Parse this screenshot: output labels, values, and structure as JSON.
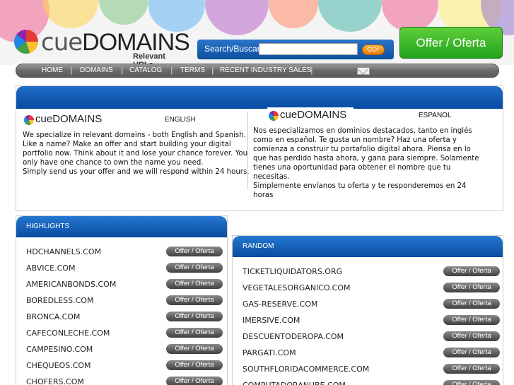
{
  "header": {
    "logo_text_cue": "cue",
    "logo_text_domains": "DOMAINS",
    "logo_subtitle": "Relevant URLs",
    "search_label": "Search/Buscar",
    "search_placeholder": "",
    "search_button": "GO!",
    "offer_button": "Offer / Oferta"
  },
  "nav": {
    "items": [
      "HOME",
      "DOMAINS",
      "CATALOG",
      "TERMS",
      "RECENT INDUSTRY SALES"
    ]
  },
  "intro": {
    "english_label": "ENGLISH",
    "spanish_label": "ESPANOL",
    "english_text": "We specialize in relevant domains - both English and Spanish. Like a name? Make an offer and start building your digital portfolio now. Think about it and lose your chance forever. You only have one chance to own the name you need.\nSimply send us your offer and we will respond within 24 hours.",
    "spanish_text": "Nos especializamos en dominios destacados, tanto en inglés como en español. Te gusta un nombre? Haz una oferta y comienza a construir tu portafolio digital ahora. Piensa en lo que has perdido hasta ahora, y gana para siempre. Solamente tienes una oportunidad para obtener el nombre que tu necesitas.\nSimplemente envíanos tu oferta y te responderemos en 24 horas"
  },
  "highlights": {
    "title": "HIGHLIGHTS",
    "button_label": "Offer / Oferta",
    "items": [
      "HDCHANNELS.COM",
      "ABVICE.COM",
      "AMERICANBONDS.COM",
      "BOREDLESS.COM",
      "BRONCA.COM",
      "CAFECONLECHE.COM",
      "CAMPESINO.COM",
      "CHEQUEOS.COM",
      "CHOFERS.COM"
    ]
  },
  "random": {
    "title": "RANDOM",
    "button_label": "Offer / Oferta",
    "items": [
      "TICKETLIQUIDATORS.ORG",
      "VEGETALESORGANICO.COM",
      "GAS-RESERVE.COM",
      "IMERSIVE.COM",
      "DESCUENTODEROPA.COM",
      "PARGATI.COM",
      "SOUTHFLORIDACOMMERCE.COM",
      "COMPUTADORANUBE.COM"
    ]
  }
}
